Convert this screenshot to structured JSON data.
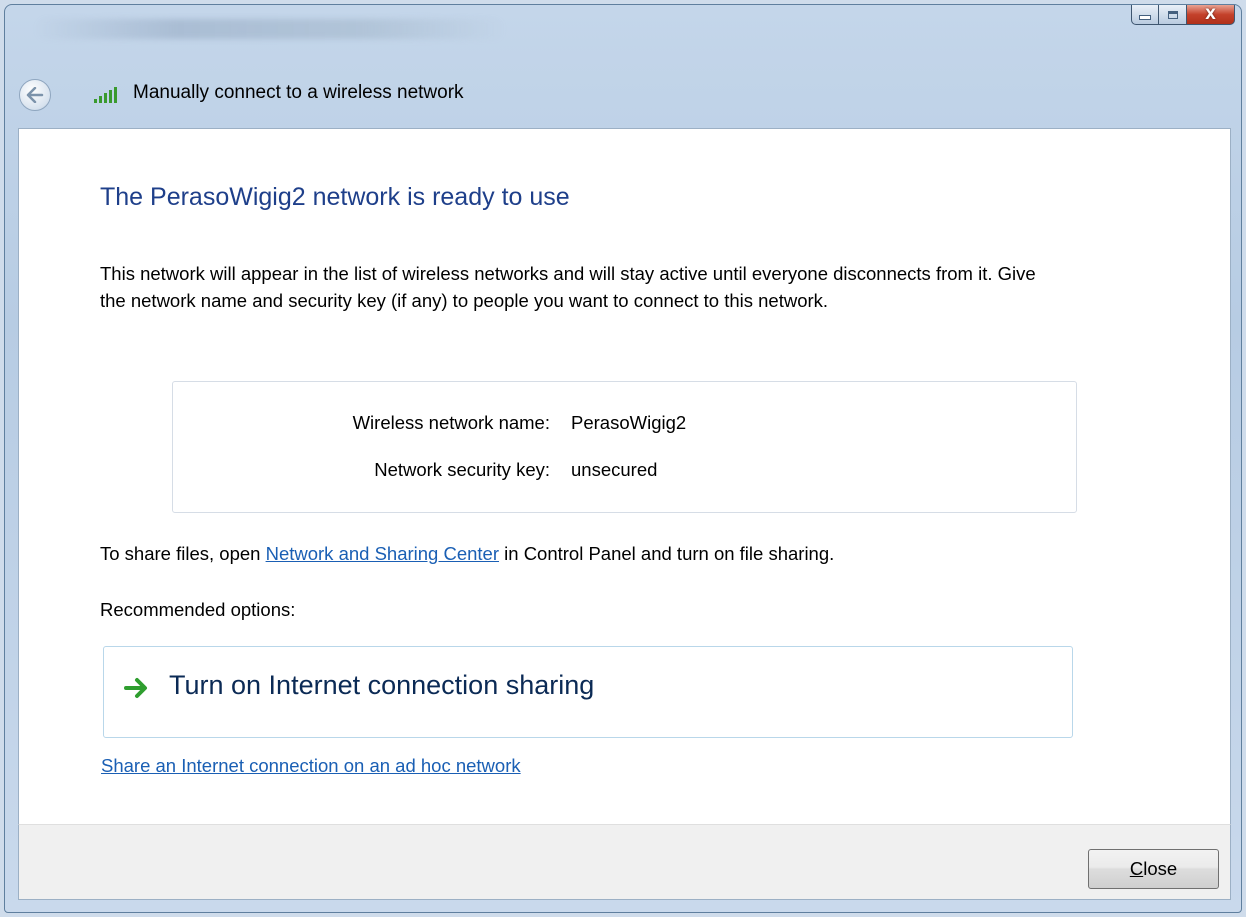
{
  "window": {
    "caption_buttons": {
      "minimize_icon": "minimize-icon",
      "maximize_icon": "maximize-icon",
      "close_glyph": "X"
    }
  },
  "nav": {
    "back_icon": "back-arrow-icon",
    "signal_icon": "wireless-signal-icon",
    "title": "Manually connect to a wireless network"
  },
  "content": {
    "heading": "The PerasoWigig2 network is ready to use",
    "description": "This network will appear in the list of wireless networks and will stay active until everyone disconnects from it. Give the network name and security key (if any) to people you want to connect to this network.",
    "info": {
      "name_label": "Wireless network name:",
      "name_value": "PerasoWigig2",
      "key_label": "Network security key:",
      "key_value": "unsecured"
    },
    "share": {
      "prefix": "To share files, open ",
      "link": "Network and Sharing Center",
      "suffix": " in Control Panel and turn on file sharing."
    },
    "recommended_label": "Recommended options:",
    "command_link": {
      "icon": "green-arrow-icon",
      "label": "Turn on Internet connection sharing"
    },
    "adhoc_link": "Share an Internet connection on an ad hoc network"
  },
  "footer": {
    "close_button": {
      "accelerator": "C",
      "rest": "lose"
    }
  },
  "colors": {
    "heading": "#1e3f8a",
    "link": "#1a5fb4",
    "command_arrow": "#2f9e2f",
    "close_button_red": "#c4412b"
  }
}
